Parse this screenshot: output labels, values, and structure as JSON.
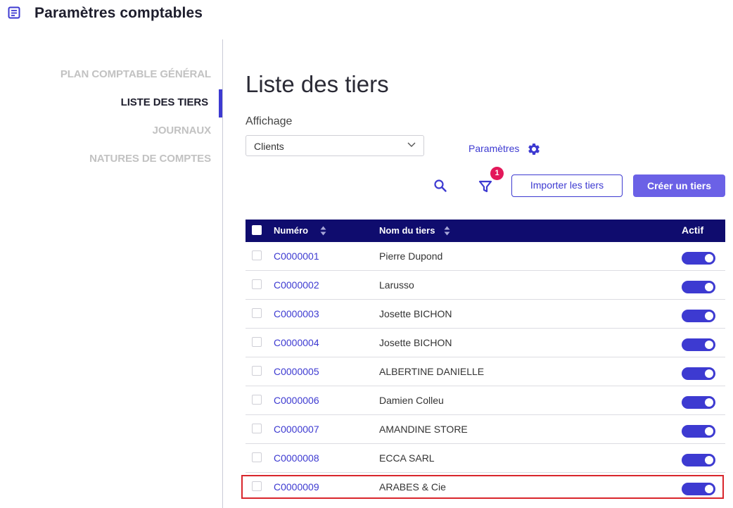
{
  "header": {
    "title": "Paramètres comptables",
    "icon": "document-list-icon"
  },
  "sidebar": {
    "items": [
      {
        "label": "PLAN COMPTABLE GÉNÉRAL",
        "active": false
      },
      {
        "label": "LISTE DES TIERS",
        "active": true
      },
      {
        "label": "JOURNAUX",
        "active": false
      },
      {
        "label": "NATURES DE COMPTES",
        "active": false
      }
    ]
  },
  "main": {
    "title": "Liste des tiers",
    "display_label": "Affichage",
    "display_value": "Clients",
    "params_label": "Paramètres",
    "filter_count": "1",
    "import_label": "Importer les tiers",
    "create_label": "Créer un tiers"
  },
  "table": {
    "headers": {
      "number": "Numéro",
      "name": "Nom du tiers",
      "active": "Actif"
    },
    "rows": [
      {
        "number": "C0000001",
        "name": "Pierre Dupond",
        "active": true
      },
      {
        "number": "C0000002",
        "name": "Larusso",
        "active": true
      },
      {
        "number": "C0000003",
        "name": "Josette BICHON",
        "active": true
      },
      {
        "number": "C0000004",
        "name": "Josette BICHON",
        "active": true
      },
      {
        "number": "C0000005",
        "name": "ALBERTINE DANIELLE",
        "active": true
      },
      {
        "number": "C0000006",
        "name": "Damien Colleu",
        "active": true
      },
      {
        "number": "C0000007",
        "name": "AMANDINE STORE",
        "active": true
      },
      {
        "number": "C0000008",
        "name": "ECCA SARL",
        "active": true
      },
      {
        "number": "C0000009",
        "name": "ARABES & Cie",
        "active": true
      }
    ]
  },
  "colors": {
    "accent": "#3d3ad1",
    "header_bg": "#0f0c6e",
    "primary_button": "#6b61e6",
    "badge": "#e3185a",
    "highlight": "#d9262c"
  }
}
